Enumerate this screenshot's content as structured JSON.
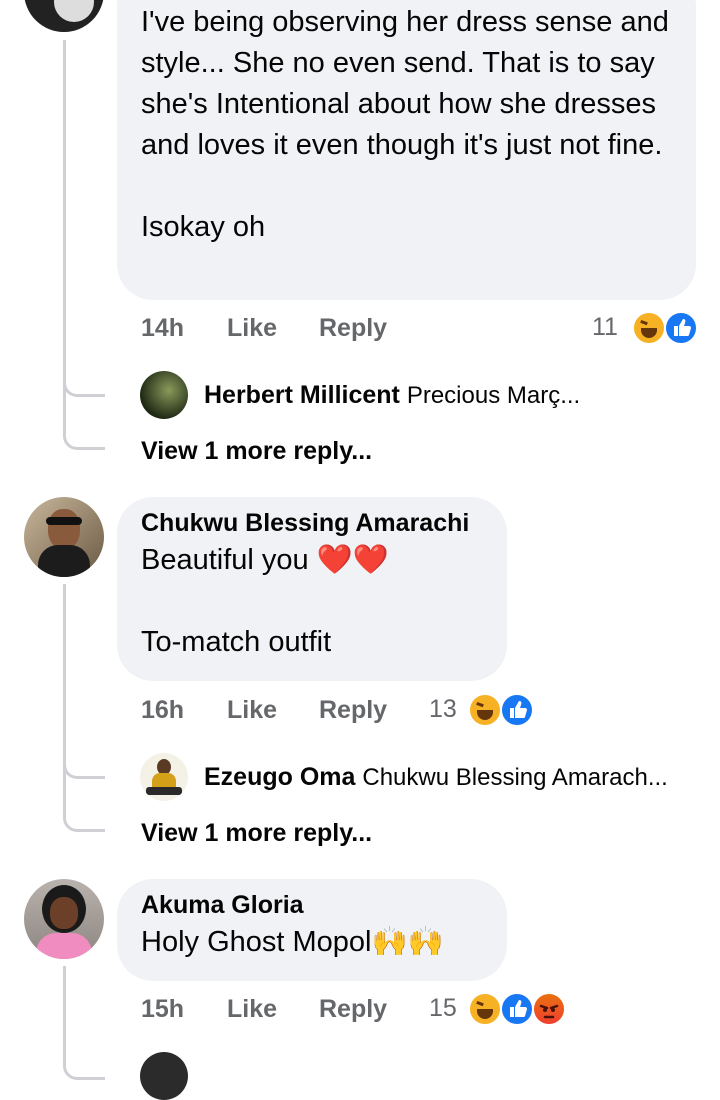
{
  "comments": [
    {
      "body": "I've being observing her dress sense and style... She no even send. That is to say she's Intentional about how she dresses and loves it even though it's just not fine.\n\nIsokay oh",
      "time": "14h",
      "like_label": "Like",
      "reply_label": "Reply",
      "reaction_count": "11",
      "reactions": [
        "haha",
        "like"
      ],
      "reply_preview": {
        "name": "Herbert Millicent",
        "text": "Precious Març..."
      },
      "view_more": "View 1 more reply..."
    },
    {
      "author": "Chukwu Blessing Amarachi",
      "body": "Beautiful you ❤️❤️\n\nTo-match outfit",
      "time": "16h",
      "like_label": "Like",
      "reply_label": "Reply",
      "reaction_count": "13",
      "reactions": [
        "haha",
        "like"
      ],
      "reply_preview": {
        "name": "Ezeugo Oma",
        "text": "Chukwu Blessing Amarach..."
      },
      "view_more": "View 1 more reply..."
    },
    {
      "author": "Akuma Gloria",
      "body": "Holy Ghost Mopol🙌🙌",
      "time": "15h",
      "like_label": "Like",
      "reply_label": "Reply",
      "reaction_count": "15",
      "reactions": [
        "haha",
        "like",
        "angry"
      ]
    }
  ],
  "colors": {
    "bubble": "#f0f2f5",
    "meta": "#65676b",
    "like": "#1877f2",
    "haha": "#f7b125",
    "thread": "#ced0d4"
  }
}
